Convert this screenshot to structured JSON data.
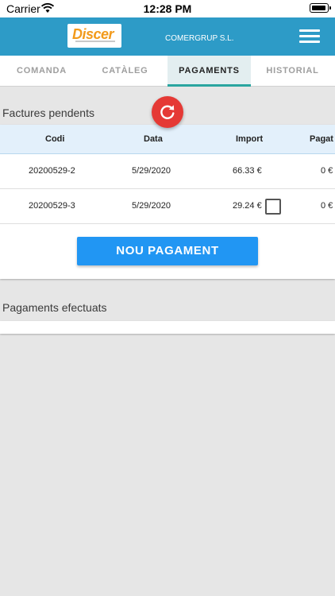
{
  "status_bar": {
    "carrier": "Carrier",
    "time": "12:28 PM"
  },
  "app_bar": {
    "company": "COMERGRUP S.L.",
    "logo_text": "Discer",
    "menu_icon": "hamburger-menu-icon"
  },
  "tabs": [
    {
      "label": "COMANDA",
      "active": false
    },
    {
      "label": "CATÀLEG",
      "active": false
    },
    {
      "label": "PAGAMENTS",
      "active": true
    },
    {
      "label": "HISTORIAL",
      "active": false
    }
  ],
  "pending": {
    "title": "Factures pendents",
    "refresh_icon": "refresh-icon",
    "columns": [
      "Codi",
      "Data",
      "Import",
      "Pagat"
    ],
    "rows": [
      {
        "code": "20200529-2",
        "date": "5/29/2020",
        "amount": "66.33 €",
        "paid": "0 €",
        "checkbox": false
      },
      {
        "code": "20200529-3",
        "date": "5/29/2020",
        "amount": "29.24 €",
        "paid": "0 €",
        "checkbox": true
      }
    ],
    "new_payment_label": "NOU PAGAMENT"
  },
  "done": {
    "title": "Pagaments efectuats"
  },
  "colors": {
    "app_bar": "#2d9bc7",
    "active_tab_indicator": "#2aa5a0",
    "refresh": "#e53935",
    "primary_button": "#2196f3",
    "logo": "#f29a1c"
  }
}
